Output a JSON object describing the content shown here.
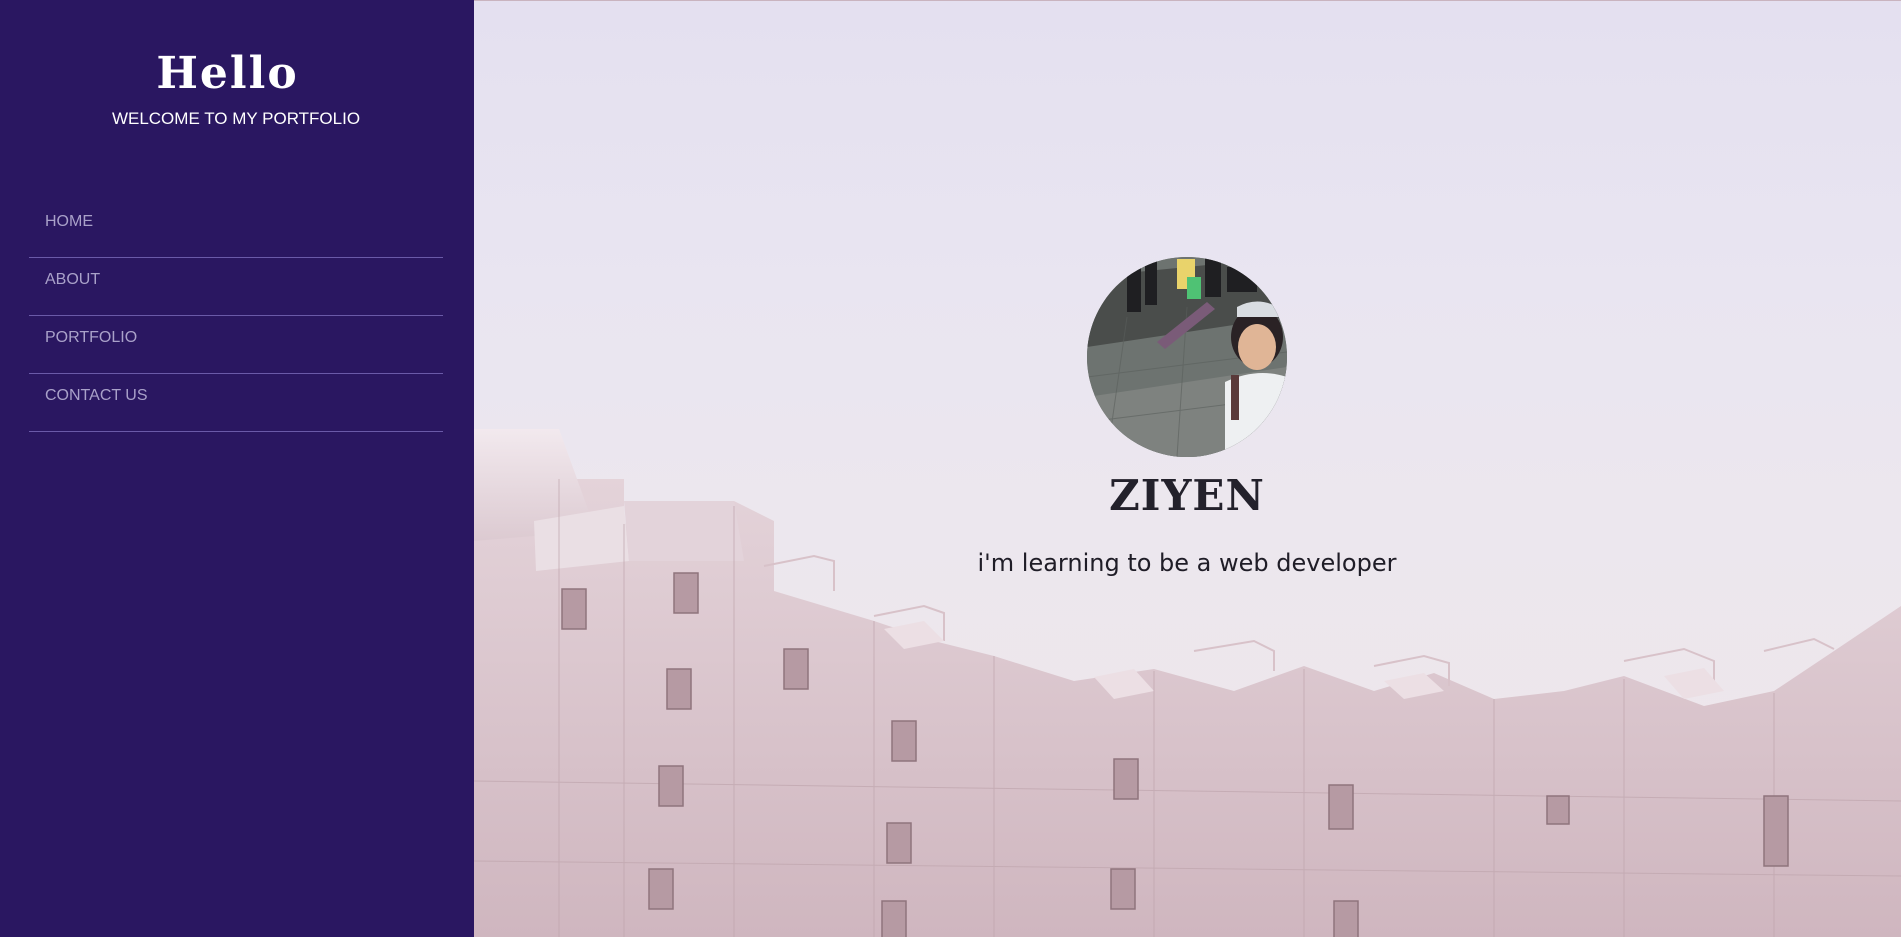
{
  "sidebar": {
    "title": "Hello",
    "subtitle": "WELCOME TO MY PORTFOLIO",
    "nav_items": [
      {
        "label": "HOME"
      },
      {
        "label": "ABOUT"
      },
      {
        "label": "PORTFOLIO"
      },
      {
        "label": "CONTACT US"
      }
    ]
  },
  "hero": {
    "name": "ZIYEN",
    "tagline": "i'm learning to be a web developer",
    "photo_alt": "profile photo"
  },
  "colors": {
    "sidebar_background": "#2a1761",
    "nav_text": "#a9a1c9",
    "nav_divider": "#6a5aa8",
    "heading_text": "#23212b",
    "building": "#dcc7cd"
  }
}
